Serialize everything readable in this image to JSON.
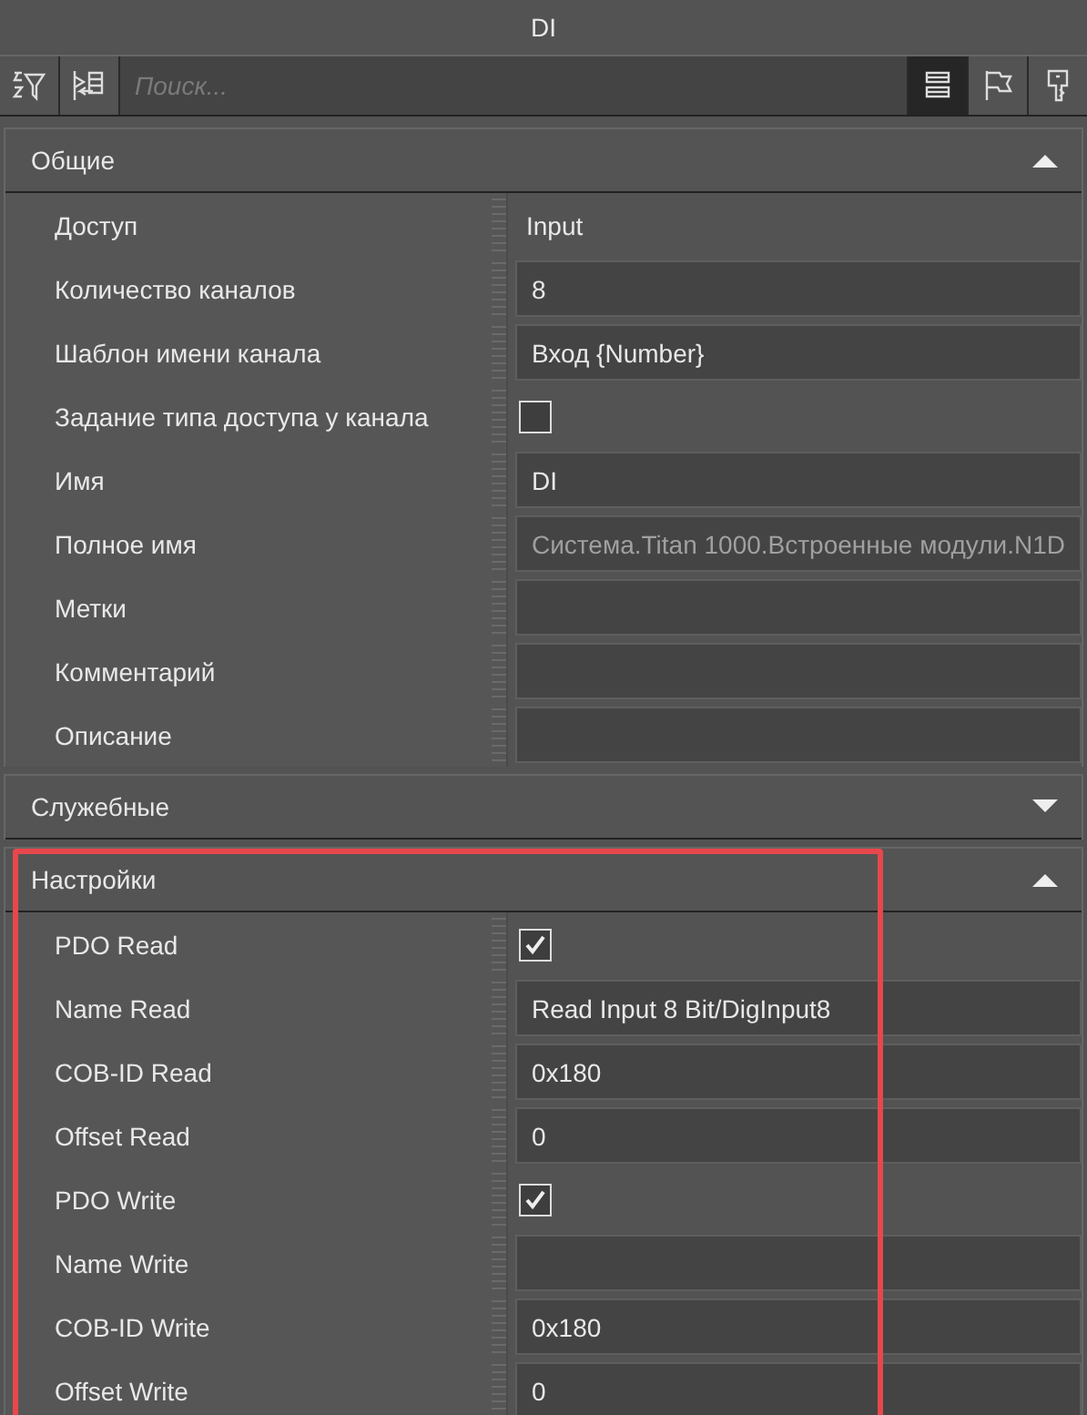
{
  "window": {
    "title": "DI"
  },
  "toolbar": {
    "left_buttons": [
      {
        "kind": "sort-filter",
        "selected": false
      },
      {
        "kind": "expand",
        "selected": false
      }
    ],
    "search": {
      "placeholder": "Поиск..."
    },
    "right_buttons": [
      {
        "kind": "list",
        "selected": true
      },
      {
        "kind": "flag",
        "selected": false
      },
      {
        "kind": "key",
        "selected": false
      }
    ]
  },
  "sections": [
    {
      "title": "Общие",
      "expanded": true,
      "rows": [
        {
          "label": "Доступ",
          "kind": "text",
          "value": "Input"
        },
        {
          "label": "Количество каналов",
          "kind": "field",
          "value": "8"
        },
        {
          "label": "Шаблон имени канала",
          "kind": "field",
          "value": "Вход {Number}"
        },
        {
          "label": "Задание типа доступа у канала",
          "kind": "checkbox",
          "checked": false
        },
        {
          "label": "Имя",
          "kind": "field",
          "value": "DI"
        },
        {
          "label": "Полное имя",
          "kind": "field",
          "value": "Система.Titan 1000.Встроенные модули.N1D",
          "disabled": true
        },
        {
          "label": "Метки",
          "kind": "field"
        },
        {
          "label": "Комментарий",
          "kind": "field"
        },
        {
          "label": "Описание",
          "kind": "field"
        }
      ]
    },
    {
      "title": "Служебные",
      "expanded": false
    },
    {
      "title": "Настройки",
      "expanded": true,
      "highlighted": true,
      "rows": [
        {
          "label": "PDO Read",
          "kind": "checkbox",
          "checked": true
        },
        {
          "label": "Name Read",
          "kind": "field",
          "value": "Read Input 8 Bit/DigInput8"
        },
        {
          "label": "COB-ID Read",
          "kind": "field",
          "value": "0x180"
        },
        {
          "label": "Offset Read",
          "kind": "field",
          "value": "0"
        },
        {
          "label": "PDO Write",
          "kind": "checkbox",
          "checked": true
        },
        {
          "label": "Name Write",
          "kind": "field"
        },
        {
          "label": "COB-ID Write",
          "kind": "field",
          "value": "0x180"
        },
        {
          "label": "Offset Write",
          "kind": "field",
          "value": "0"
        }
      ]
    }
  ]
}
